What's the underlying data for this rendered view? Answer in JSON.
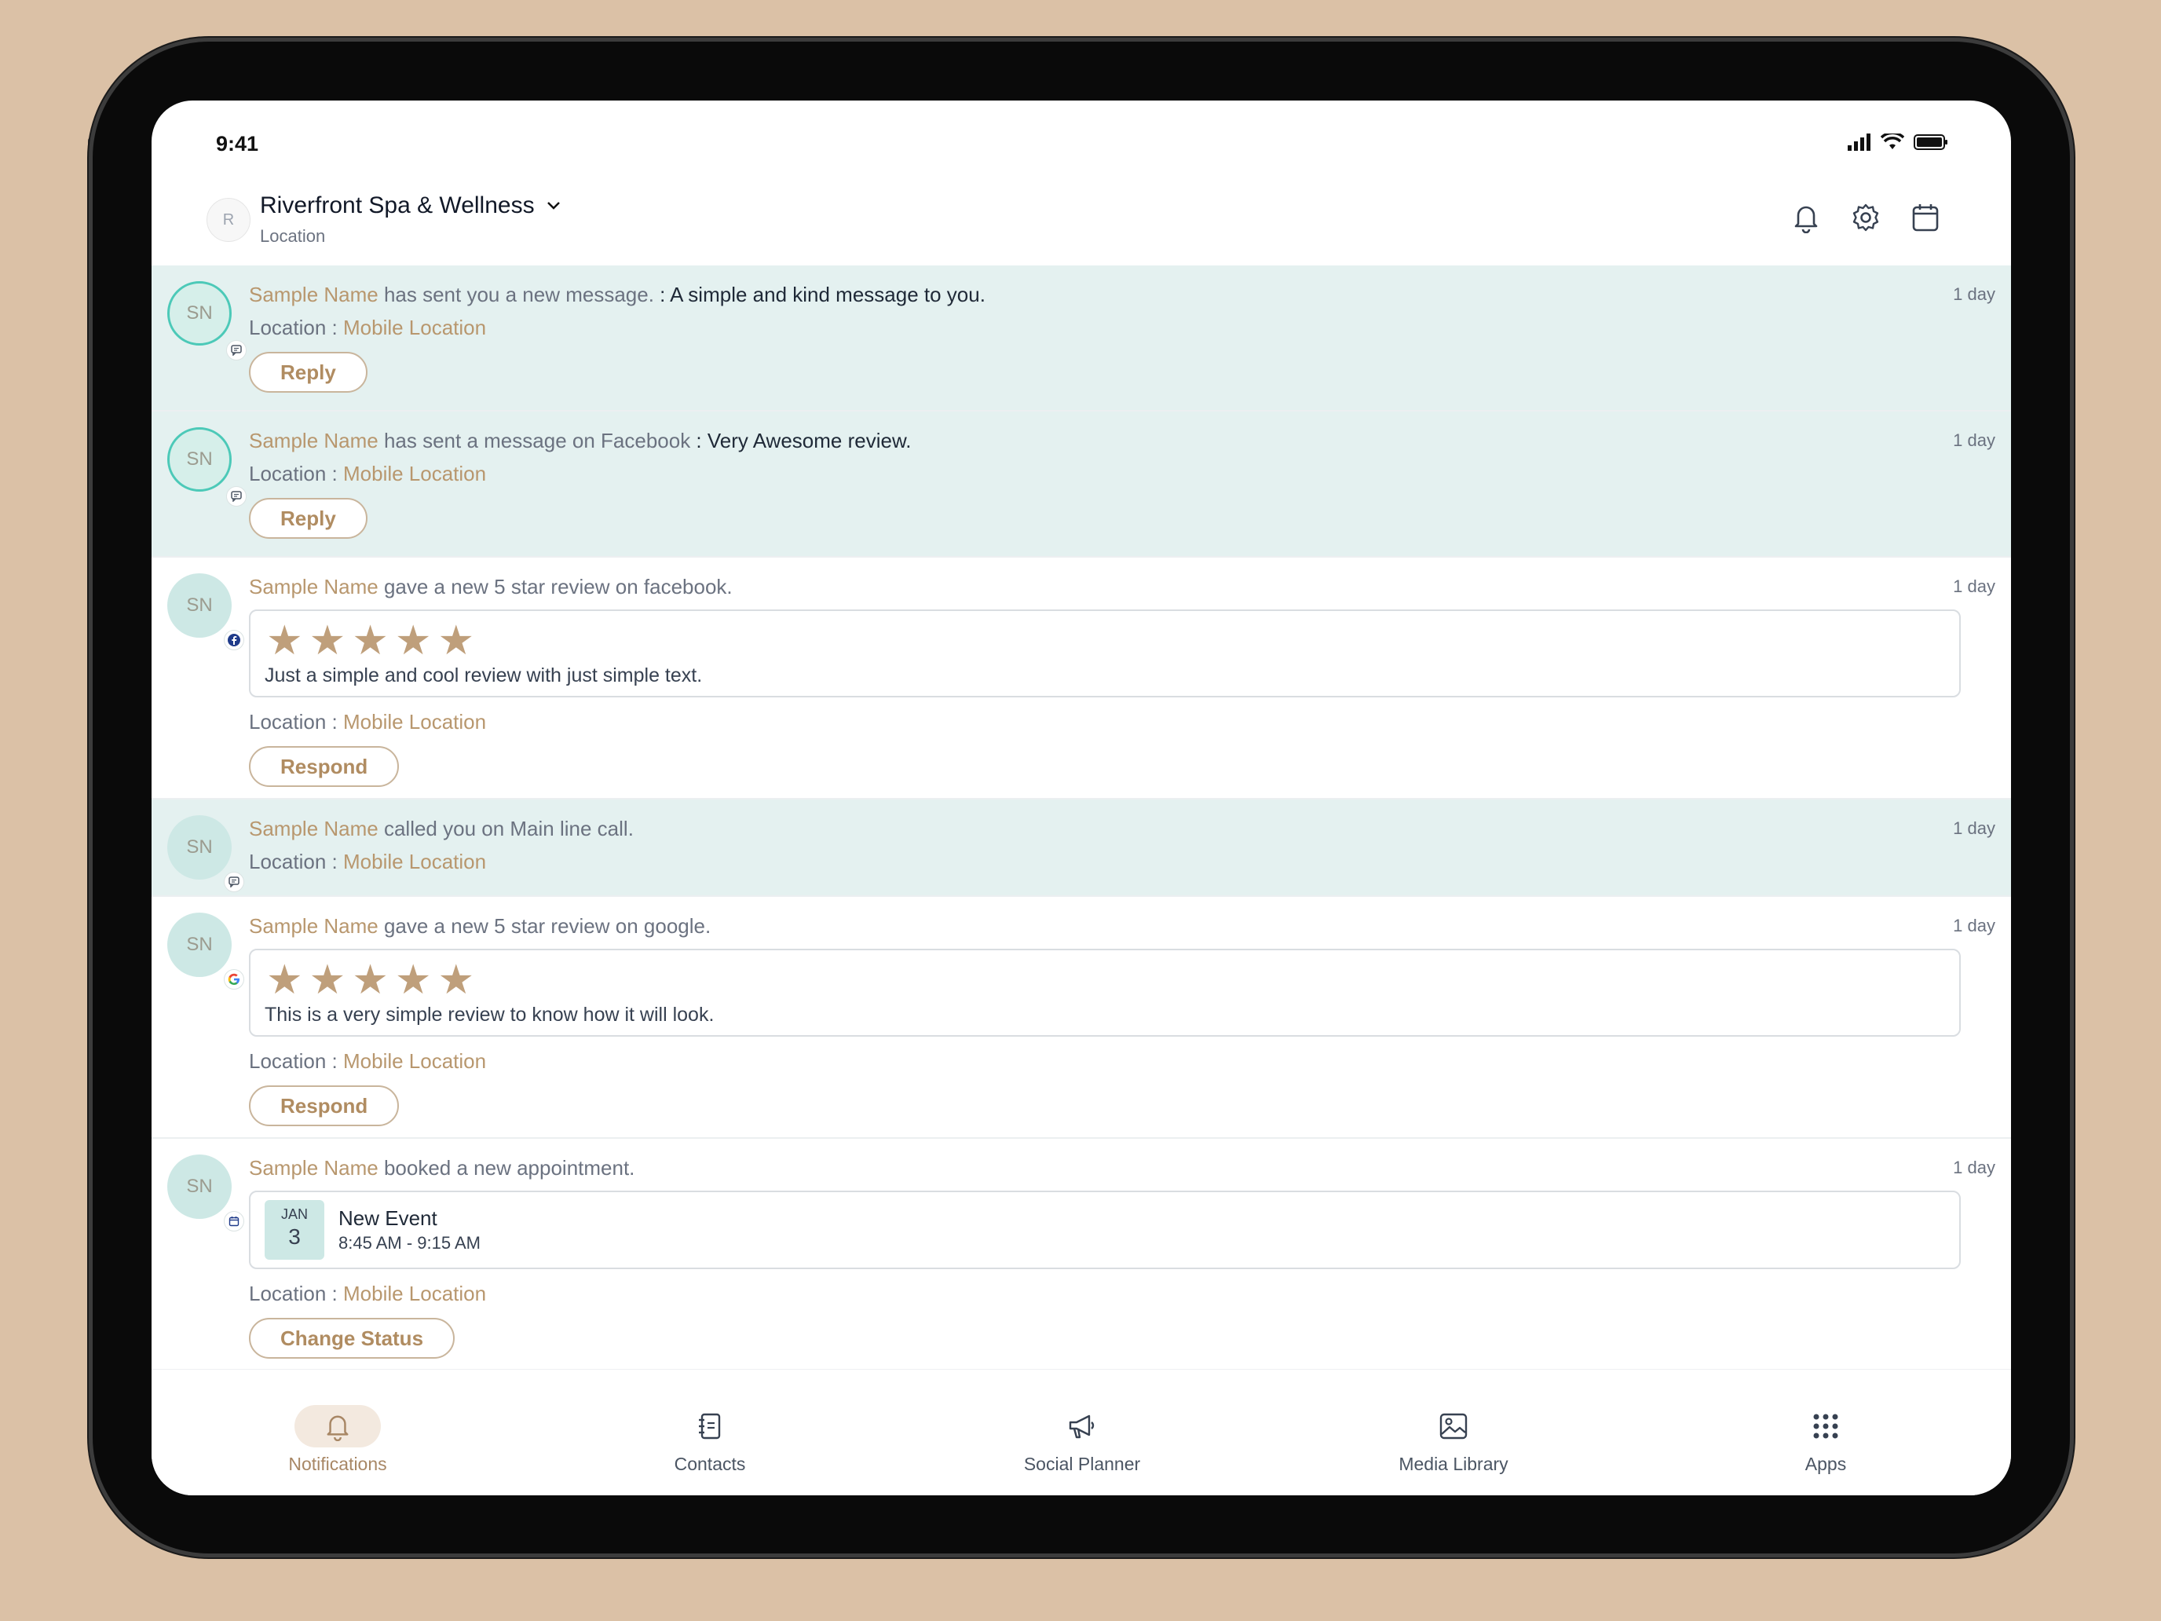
{
  "status_bar": {
    "time": "9:41"
  },
  "header": {
    "avatar_initial": "R",
    "location_name": "Riverfront Spa & Wellness",
    "location_sub": "Location"
  },
  "notifications": [
    {
      "initials": "SN",
      "name": "Sample Name",
      "action": " has sent you a new message.",
      "message": " : A simple and kind message to you.",
      "time": "1 day",
      "loc_label": "Location : ",
      "loc_value": "Mobile Location",
      "button": "Reply",
      "badge": "message-icon"
    },
    {
      "initials": "SN",
      "name": "Sample Name",
      "action": " has sent a message on Facebook",
      "message": " : Very Awesome review.",
      "time": "1 day",
      "loc_label": "Location : ",
      "loc_value": "Mobile Location",
      "button": "Reply",
      "badge": "message-icon"
    },
    {
      "initials": "SN",
      "name": "Sample Name",
      "action": " gave a new 5 star review on facebook.",
      "time": "1 day",
      "rating": 5,
      "review": "Just a simple and cool review with just simple text.",
      "loc_label": "Location : ",
      "loc_value": "Mobile Location",
      "button": "Respond",
      "badge": "facebook-icon"
    },
    {
      "initials": "SN",
      "name": "Sample Name",
      "action": " called you on Main line call.",
      "time": "1 day",
      "loc_label": "Location : ",
      "loc_value": "Mobile Location",
      "badge": "message-icon"
    },
    {
      "initials": "SN",
      "name": "Sample Name",
      "action": " gave a new 5 star review on google.",
      "time": "1 day",
      "rating": 5,
      "review": "This is a very simple review to know how it will look.",
      "loc_label": "Location : ",
      "loc_value": "Mobile Location",
      "button": "Respond",
      "badge": "google-icon"
    },
    {
      "initials": "SN",
      "name": "Sample Name",
      "action": " booked a new appointment.",
      "time": "1 day",
      "event": {
        "month": "JAN",
        "day": "3",
        "title": "New Event",
        "time": "8:45 AM - 9:15 AM"
      },
      "loc_label": "Location : ",
      "loc_value": "Mobile Location",
      "button": "Change Status",
      "badge": "calendar-icon"
    }
  ],
  "tabs": [
    {
      "label": "Notifications",
      "icon": "bell-icon",
      "active": true
    },
    {
      "label": "Contacts",
      "icon": "contacts-icon"
    },
    {
      "label": "Social Planner",
      "icon": "megaphone-icon"
    },
    {
      "label": "Media Library",
      "icon": "image-icon"
    },
    {
      "label": "Apps",
      "icon": "grid-icon"
    }
  ],
  "colors": {
    "accent": "#b8976e",
    "unread_bg": "#e4f1f0",
    "avatar_bg": "#cde8e5",
    "ring": "#4cc9b8",
    "star": "#bf9f7b",
    "frame_bg": "#dbc1a6"
  }
}
